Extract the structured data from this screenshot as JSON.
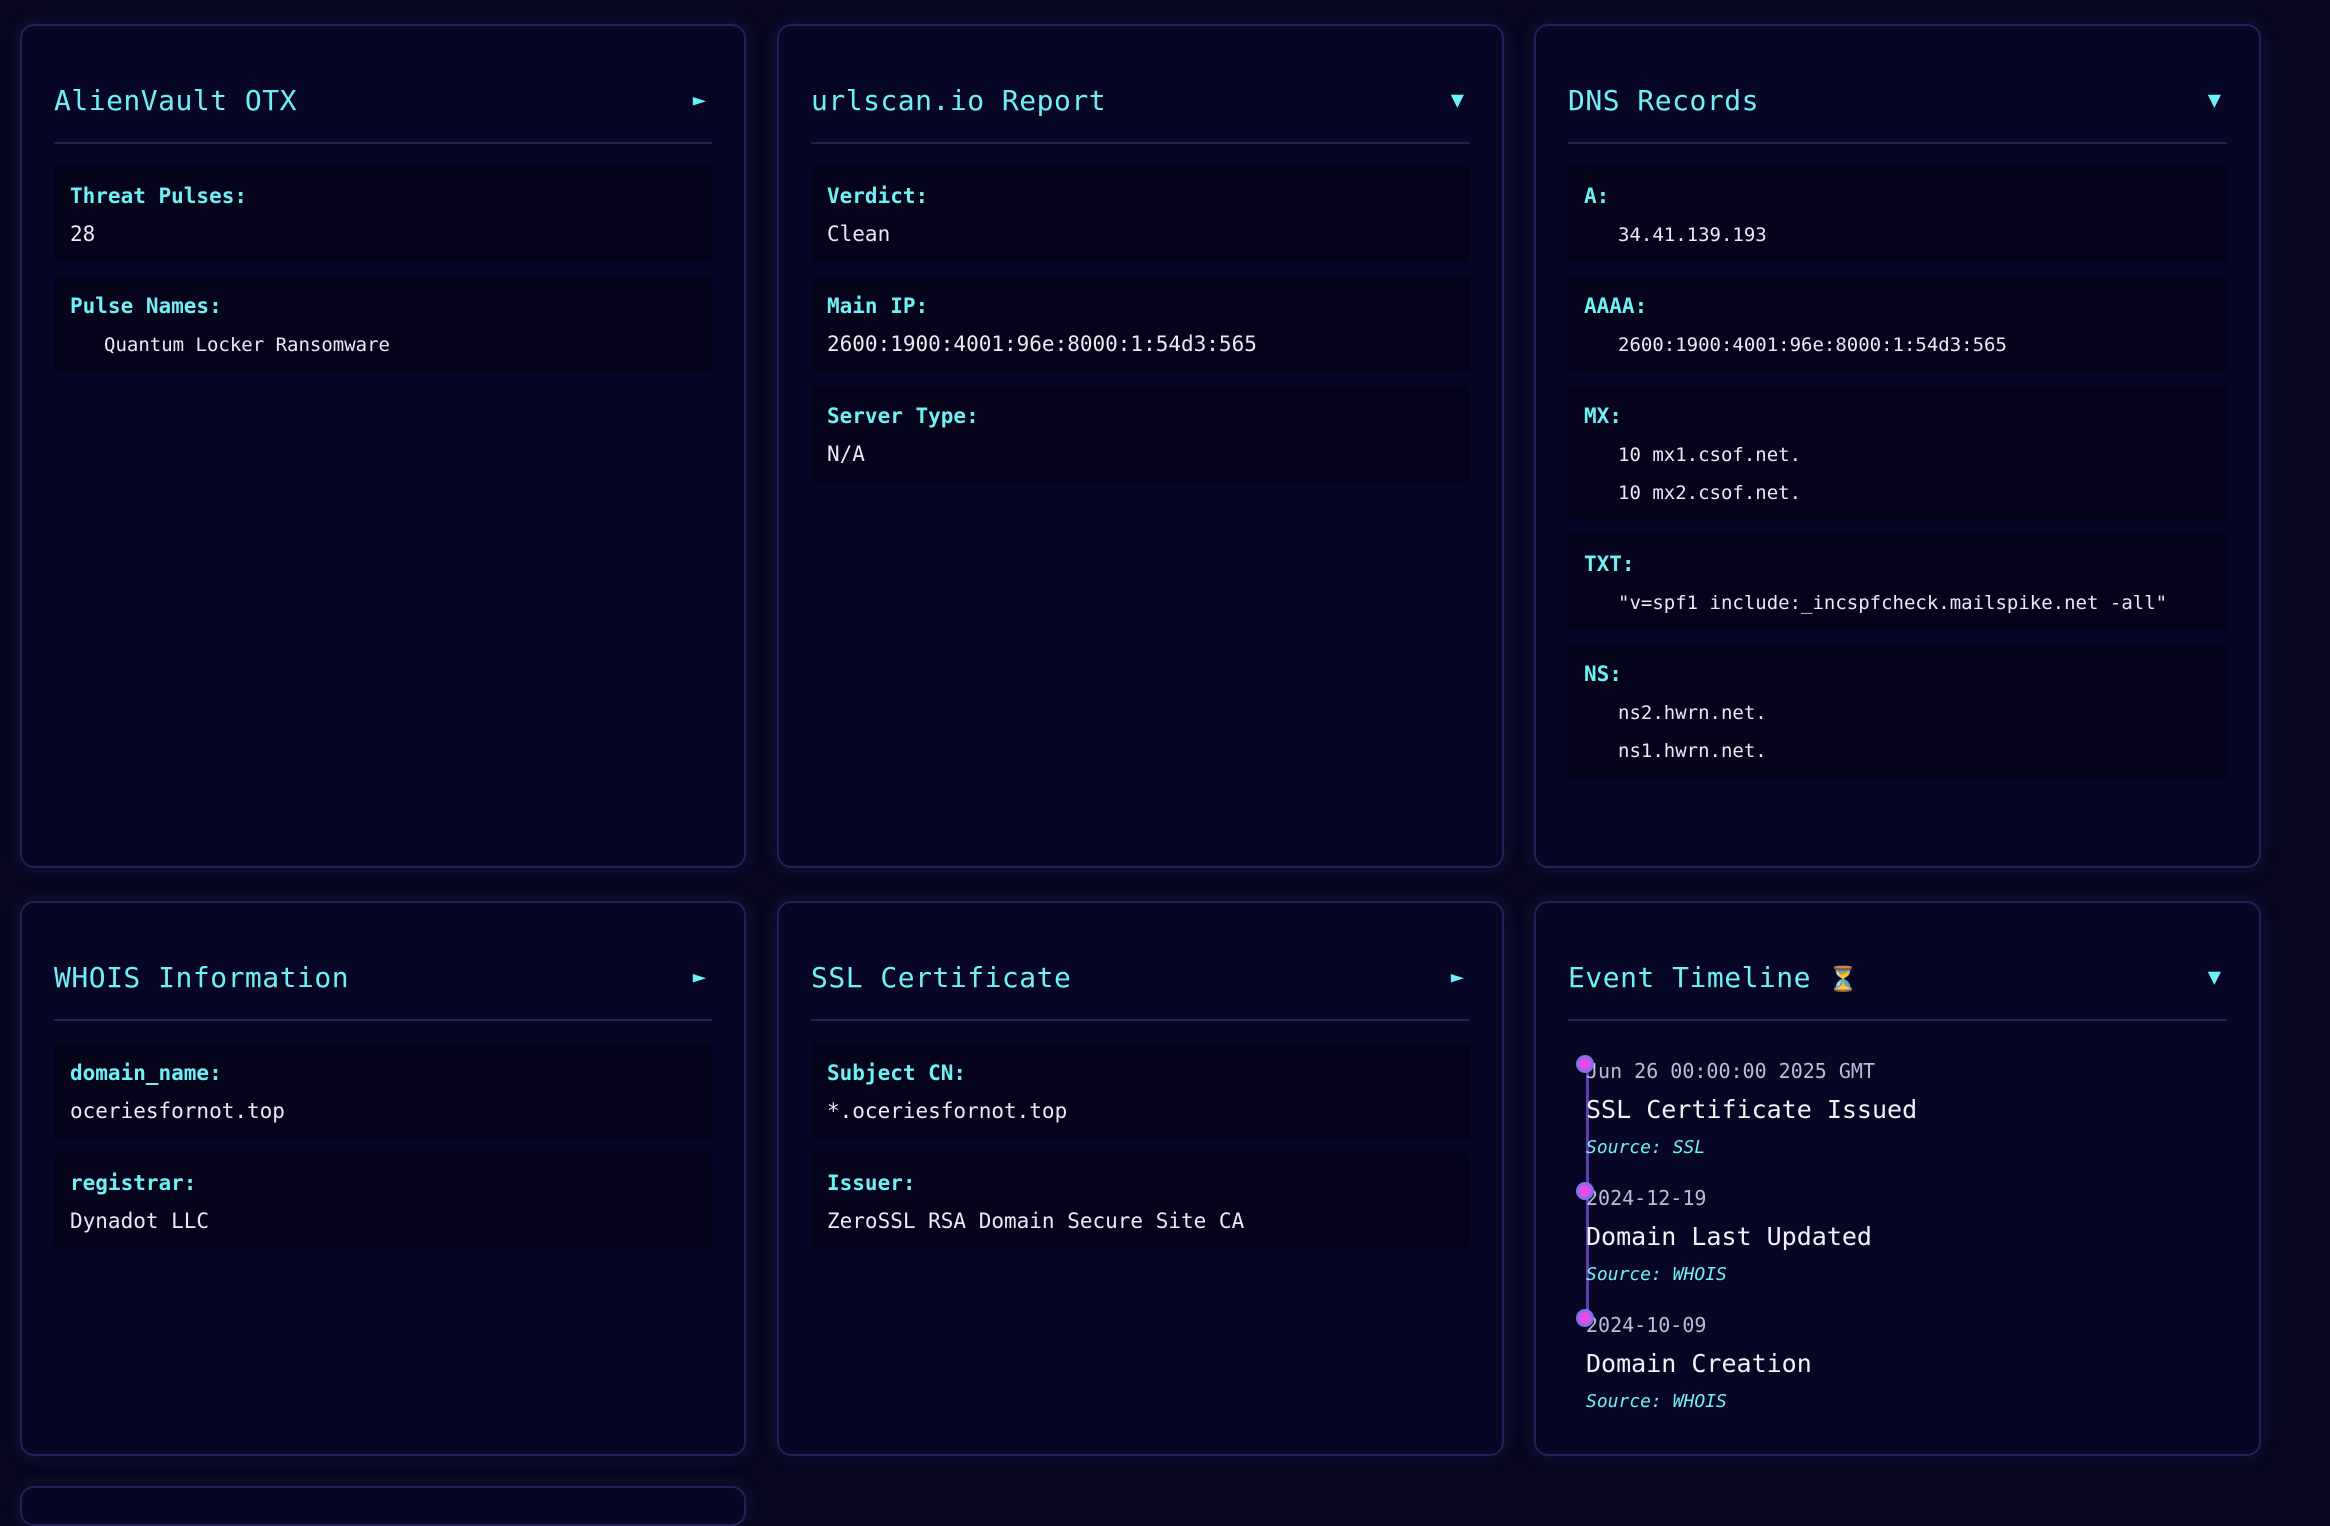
{
  "colors": {
    "accent": "#6ff0f6",
    "background": "#09081f",
    "card": "#080625",
    "timeline_dot": "#e54ce8"
  },
  "otx": {
    "title": "AlienVault OTX",
    "toggle": "►",
    "threat_pulses_label": "Threat Pulses:",
    "threat_pulses_value": "28",
    "pulse_names_label": "Pulse Names:",
    "pulse_names": [
      "Quantum Locker Ransomware"
    ]
  },
  "urlscan": {
    "title": "urlscan.io Report",
    "toggle": "▼",
    "verdict_label": "Verdict:",
    "verdict_value": "Clean",
    "main_ip_label": "Main IP:",
    "main_ip_value": "2600:1900:4001:96e:8000:1:54d3:565",
    "server_type_label": "Server Type:",
    "server_type_value": "N/A"
  },
  "dns": {
    "title": "DNS Records",
    "toggle": "▼",
    "records": [
      {
        "label": "A:",
        "values": [
          "34.41.139.193"
        ]
      },
      {
        "label": "AAAA:",
        "values": [
          "2600:1900:4001:96e:8000:1:54d3:565"
        ]
      },
      {
        "label": "MX:",
        "values": [
          "10 mx1.csof.net.",
          "10 mx2.csof.net."
        ]
      },
      {
        "label": "TXT:",
        "values": [
          "\"v=spf1 include:_incspfcheck.mailspike.net -all\""
        ]
      },
      {
        "label": "NS:",
        "values": [
          "ns2.hwrn.net.",
          "ns1.hwrn.net."
        ]
      }
    ]
  },
  "whois": {
    "title": "WHOIS Information",
    "toggle": "►",
    "domain_name_label": "domain_name:",
    "domain_name_value": "oceriesfornot.top",
    "registrar_label": "registrar:",
    "registrar_value": "Dynadot LLC"
  },
  "ssl": {
    "title": "SSL Certificate",
    "toggle": "►",
    "subject_cn_label": "Subject CN:",
    "subject_cn_value": "*.oceriesfornot.top",
    "issuer_label": "Issuer:",
    "issuer_value": "ZeroSSL RSA Domain Secure Site CA"
  },
  "timeline": {
    "title": "Event Timeline",
    "title_icon": "⏳",
    "toggle": "▼",
    "events": [
      {
        "date": "Jun 26 00:00:00 2025 GMT",
        "title": "SSL Certificate Issued",
        "source": "Source: SSL"
      },
      {
        "date": "2024-12-19",
        "title": "Domain Last Updated",
        "source": "Source: WHOIS"
      },
      {
        "date": "2024-10-09",
        "title": "Domain Creation",
        "source": "Source: WHOIS"
      }
    ]
  }
}
